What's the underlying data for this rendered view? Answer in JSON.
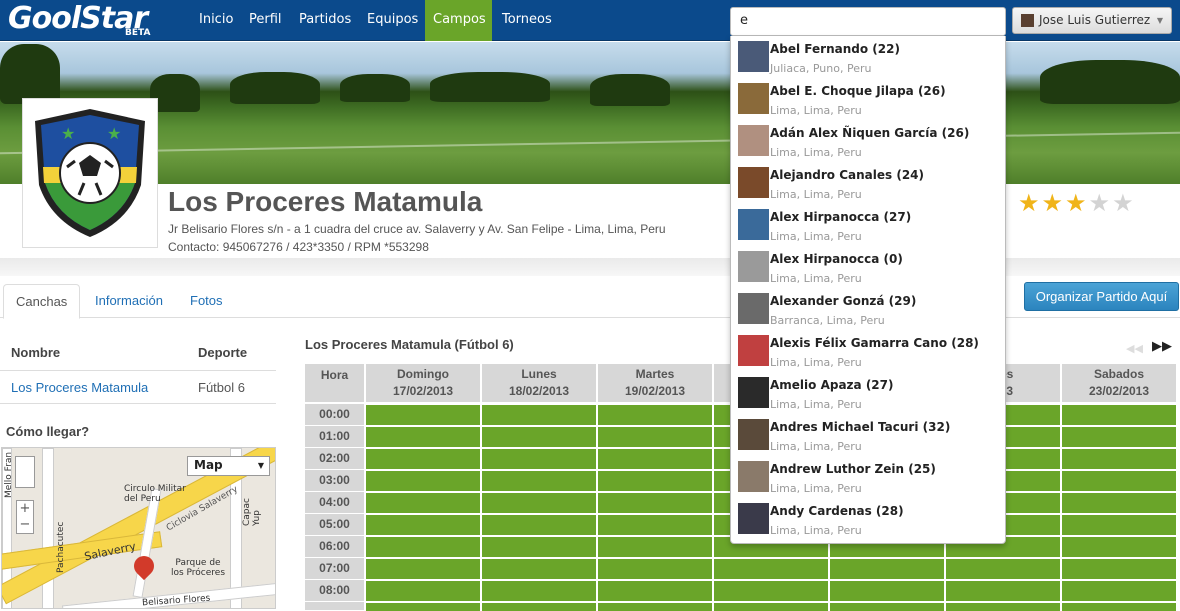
{
  "nav": {
    "logo_text": "GoolStar",
    "logo_badge": "BETA",
    "items": [
      {
        "label": "Inicio",
        "active": false
      },
      {
        "label": "Perfil",
        "active": false
      },
      {
        "label": "Partidos",
        "active": false
      },
      {
        "label": "Equipos",
        "active": false
      },
      {
        "label": "Campos",
        "active": true
      },
      {
        "label": "Torneos",
        "active": false
      }
    ],
    "search_value": "e",
    "user_name": "Jose Luis Gutierrez",
    "accent_color": "#0b4a8c",
    "active_color": "#6aa529"
  },
  "venue": {
    "name": "Los Proceres Matamula",
    "address": "Jr Belisario Flores s/n - a 1 cuadra del cruce av. Salaverry y Av. San Felipe - Lima, Lima, Peru",
    "contact": "Contacto: 945067276 / 423*3350 / RPM *553298",
    "rating": 3,
    "rating_max": 5
  },
  "tabs": [
    {
      "label": "Canchas",
      "active": true
    },
    {
      "label": "Información",
      "active": false
    },
    {
      "label": "Fotos",
      "active": false
    }
  ],
  "organize_button": "Organizar Partido Aquí",
  "courts_table": {
    "headers": {
      "name": "Nombre",
      "sport": "Deporte"
    },
    "rows": [
      {
        "name": "Los Proceres Matamula",
        "sport": "Fútbol 6"
      }
    ]
  },
  "directions": {
    "title": "Cómo llegar?",
    "map_type": "Map",
    "labels": [
      "Mello Fran",
      "Circulo Militar del Peru",
      "Ciclovia Salaverry",
      "Capac Yup",
      "Pachacutec",
      "Salaverry",
      "Parque de los Próceres",
      "Belisario Flores"
    ]
  },
  "schedule": {
    "title": "Los Proceres Matamula (Fútbol 6)",
    "hour_header": "Hora",
    "days": [
      {
        "name": "Domingo",
        "date": "17/02/2013"
      },
      {
        "name": "Lunes",
        "date": "18/02/2013"
      },
      {
        "name": "Martes",
        "date": "19/02/2013"
      },
      {
        "name": "",
        "date": ""
      },
      {
        "name": "",
        "date": ""
      },
      {
        "name": "nes",
        "date": "013"
      },
      {
        "name": "Sabados",
        "date": "23/02/2013"
      }
    ],
    "hours": [
      "00:00",
      "01:00",
      "02:00",
      "03:00",
      "04:00",
      "05:00",
      "06:00",
      "07:00",
      "08:00"
    ],
    "available_color": "#6aa529"
  },
  "search_results": [
    {
      "name": "Abel Fernando (22)",
      "location": "Juliaca, Puno, Peru",
      "photo": "#4a5a78"
    },
    {
      "name": "Abel E. Choque Jilapa (26)",
      "location": "Lima, Lima, Peru",
      "photo": "#8a6a3a"
    },
    {
      "name": "Adán Alex Ñiquen García (26)",
      "location": "Lima, Lima, Peru",
      "photo": "#b09080"
    },
    {
      "name": "Alejandro Canales (24)",
      "location": "Lima, Lima, Peru",
      "photo": "#7a4a2a"
    },
    {
      "name": "Alex Hirpanocca (27)",
      "location": "Lima, Lima, Peru",
      "photo": "#3a6a9a"
    },
    {
      "name": "Alex Hirpanocca (0)",
      "location": "Lima, Lima, Peru",
      "photo": "#9a9a9a"
    },
    {
      "name": "Alexander Gonzá (29)",
      "location": "Barranca, Lima, Peru",
      "photo": "#6a6a6a"
    },
    {
      "name": "Alexis Félix Gamarra Cano (28)",
      "location": "Lima, Lima, Peru",
      "photo": "#c04040"
    },
    {
      "name": "Amelio Apaza (27)",
      "location": "Lima, Lima, Peru",
      "photo": "#2a2a2a"
    },
    {
      "name": "Andres Michael Tacuri (32)",
      "location": "Lima, Lima, Peru",
      "photo": "#5a4a3a"
    },
    {
      "name": "Andrew Luthor Zein (25)",
      "location": "Lima, Lima, Peru",
      "photo": "#8a7a6a"
    },
    {
      "name": "Andy Cardenas (28)",
      "location": "Lima, Lima, Peru",
      "photo": "#3a3a4a"
    }
  ]
}
